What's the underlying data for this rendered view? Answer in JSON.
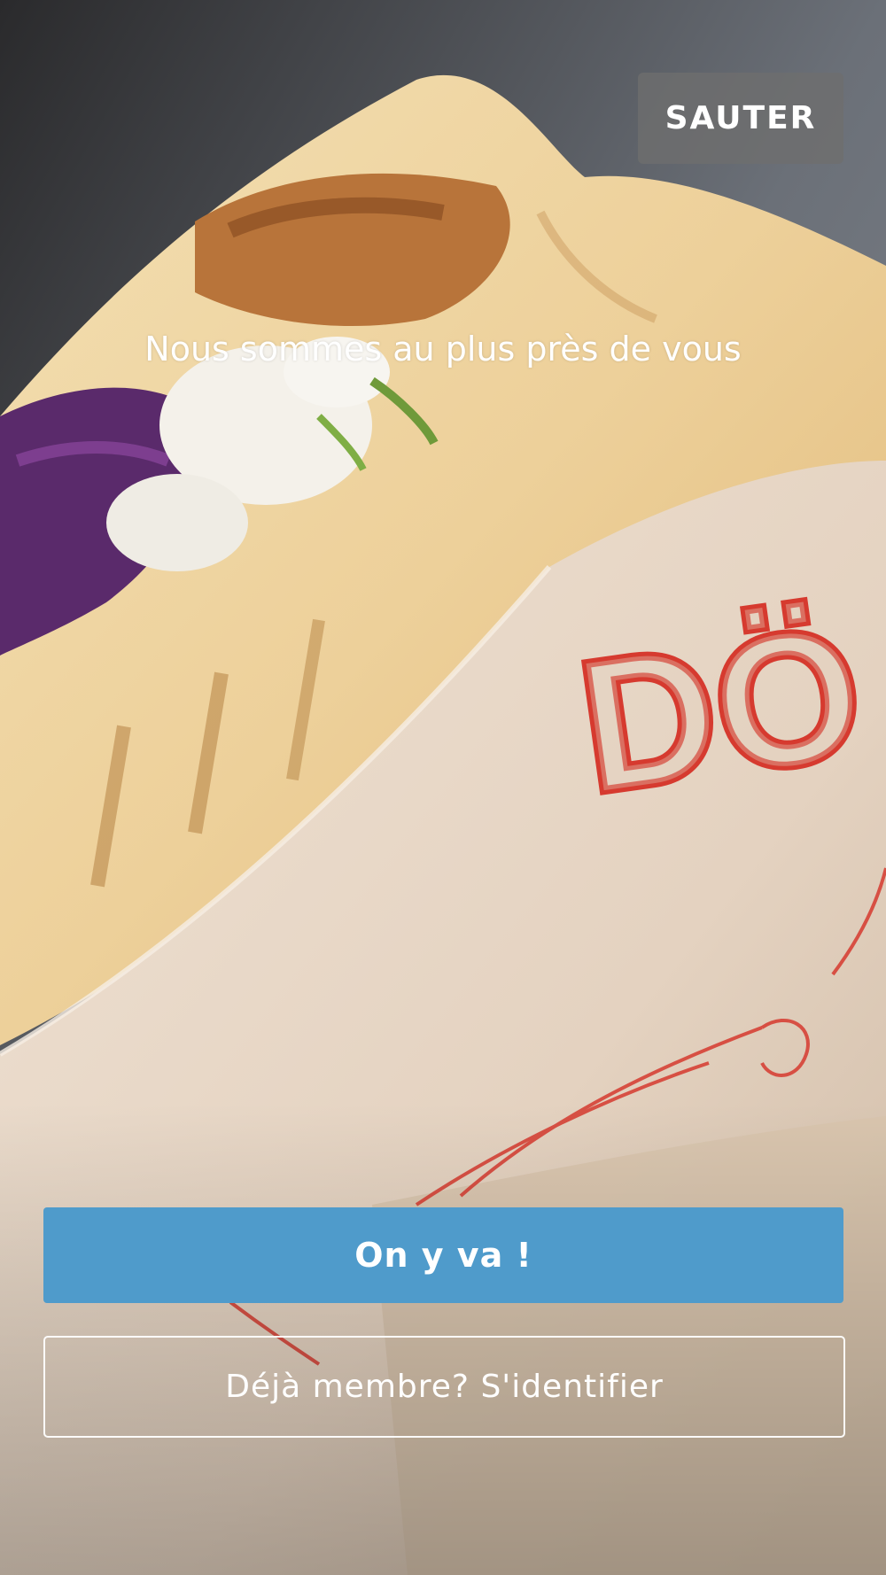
{
  "onboarding": {
    "skip_label": "SAUTER",
    "tagline": "Nous sommes au plus près de vous",
    "primary_label": "On y va !",
    "secondary_label": "Déjà membre? S'identifier",
    "background": {
      "wrapper_brand_text": "DÖ"
    }
  },
  "colors": {
    "primary_button": "#4f9bcb",
    "wrapper_red": "#d63a2f"
  }
}
